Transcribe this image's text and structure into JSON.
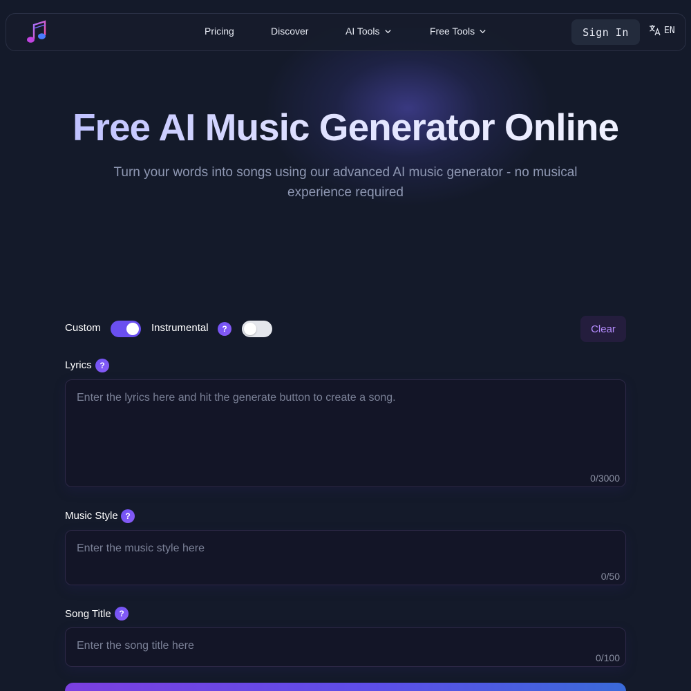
{
  "nav": {
    "items": [
      {
        "label": "Pricing",
        "has_dropdown": false
      },
      {
        "label": "Discover",
        "has_dropdown": false
      },
      {
        "label": "AI Tools",
        "has_dropdown": true
      },
      {
        "label": "Free Tools",
        "has_dropdown": true
      }
    ],
    "sign_in": "Sign In",
    "language": "EN",
    "logo_icon": "music-note-icon",
    "language_icon": "translate-icon"
  },
  "hero": {
    "title": "Free AI Music Generator Online",
    "subtitle": "Turn your words into songs using our advanced AI music generator - no musical experience required"
  },
  "form": {
    "custom_label": "Custom",
    "custom_on": true,
    "instrumental_label": "Instrumental",
    "instrumental_on": false,
    "clear_label": "Clear",
    "help_glyph": "?",
    "lyrics": {
      "label": "Lyrics",
      "placeholder": "Enter the lyrics here and hit the generate button to create a song.",
      "count": "0/3000"
    },
    "music_style": {
      "label": "Music Style",
      "placeholder": "Enter the music style here",
      "count": "0/50"
    },
    "song_title": {
      "label": "Song Title",
      "placeholder": "Enter the song title here",
      "count": "0/100"
    }
  },
  "colors": {
    "background": "#141a2a",
    "accent": "#6a4ff0",
    "clear_text": "#b58cff"
  }
}
